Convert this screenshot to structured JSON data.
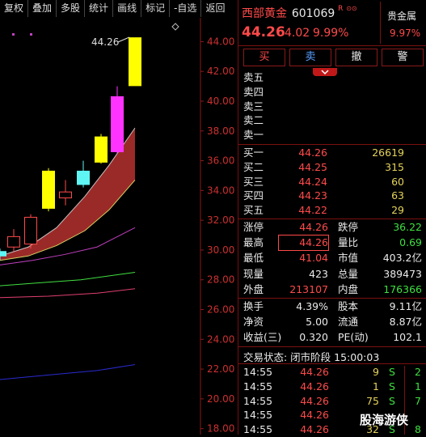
{
  "toolbar": {
    "items": [
      "复权",
      "叠加",
      "多股",
      "统计",
      "画线",
      "标记",
      "-自选",
      "返回"
    ]
  },
  "chart": {
    "peak_label": "44.26",
    "y_ticks": [
      "44.00",
      "42.00",
      "40.00",
      "38.00",
      "36.00",
      "34.00",
      "32.00",
      "30.00",
      "28.00",
      "26.00",
      "24.00",
      "22.00",
      "20.00",
      "18.00"
    ]
  },
  "chart_data": {
    "type": "candlestick",
    "y_range": [
      17.6,
      45.6
    ],
    "candles": [
      {
        "o": 29.6,
        "c": 29.9,
        "h": 30.1,
        "l": 29.3,
        "color": "cyan"
      },
      {
        "o": 30.2,
        "c": 30.9,
        "h": 31.4,
        "l": 29.9,
        "color": "red"
      },
      {
        "o": 30.4,
        "c": 32.2,
        "h": 32.4,
        "l": 30.1,
        "color": "red"
      },
      {
        "o": 32.8,
        "c": 35.3,
        "h": 35.5,
        "l": 32.6,
        "color": "yellow"
      },
      {
        "o": 33.5,
        "c": 33.9,
        "h": 34.7,
        "l": 33.0,
        "color": "red"
      },
      {
        "o": 35.3,
        "c": 34.4,
        "h": 36.0,
        "l": 34.2,
        "color": "cyan"
      },
      {
        "o": 35.9,
        "c": 37.6,
        "h": 37.8,
        "l": 35.8,
        "color": "yellow"
      },
      {
        "o": 36.6,
        "c": 40.3,
        "h": 41.0,
        "l": 36.5,
        "color": "magenta"
      },
      {
        "o": 41.04,
        "c": 44.26,
        "h": 44.26,
        "l": 41.04,
        "color": "yellow"
      }
    ],
    "ma_bands": [
      {
        "color": "#d8d060",
        "points": [
          [
            0,
            29.3
          ],
          [
            35,
            29.6
          ],
          [
            70,
            30.3
          ],
          [
            105,
            31.3
          ],
          [
            135,
            32.7
          ],
          [
            167,
            34.7
          ]
        ]
      },
      {
        "color": "#c7c0c0",
        "points": [
          [
            0,
            29.6
          ],
          [
            35,
            30.2
          ],
          [
            70,
            31.5
          ],
          [
            105,
            33.6
          ],
          [
            135,
            35.7
          ],
          [
            167,
            38.2
          ]
        ]
      },
      {
        "color": "#c040c0",
        "points": [
          [
            0,
            29.0
          ],
          [
            40,
            29.3
          ],
          [
            80,
            29.7
          ],
          [
            120,
            30.2
          ],
          [
            167,
            31.5
          ]
        ]
      },
      {
        "color": "#40e040",
        "points": [
          [
            0,
            27.6
          ],
          [
            50,
            27.8
          ],
          [
            100,
            28.0
          ],
          [
            167,
            28.5
          ]
        ]
      },
      {
        "color": "#e04070",
        "points": [
          [
            0,
            26.8
          ],
          [
            60,
            26.9
          ],
          [
            120,
            27.1
          ],
          [
            167,
            27.4
          ]
        ]
      },
      {
        "color": "#2a2ad0",
        "points": [
          [
            0,
            21.3
          ],
          [
            60,
            21.6
          ],
          [
            120,
            21.9
          ],
          [
            167,
            22.3
          ]
        ]
      }
    ]
  },
  "stock": {
    "name": "西部黄金",
    "code": "601069",
    "tag": "R",
    "price": "44.26",
    "change": "4.02",
    "change_pct": "9.99%",
    "sector": "贵金属",
    "sector_pct": "9.97%"
  },
  "buttons": [
    "买",
    "卖",
    "撤",
    "警"
  ],
  "sell_labels": [
    "卖五",
    "卖四",
    "卖三",
    "卖二",
    "卖一"
  ],
  "buy_levels": [
    {
      "label": "买一",
      "price": "44.26",
      "vol": "26619"
    },
    {
      "label": "买二",
      "price": "44.25",
      "vol": "315"
    },
    {
      "label": "买三",
      "price": "44.24",
      "vol": "60"
    },
    {
      "label": "买四",
      "price": "44.23",
      "vol": "63"
    },
    {
      "label": "买五",
      "price": "44.22",
      "vol": "29"
    }
  ],
  "stats1": [
    {
      "l1": "涨停",
      "v1": "44.26",
      "l2": "跌停",
      "v2": "36.22"
    },
    {
      "l1": "最高",
      "v1": "44.26",
      "l2": "量比",
      "v2": "0.69"
    },
    {
      "l1": "最低",
      "v1": "41.04",
      "l2": "市值",
      "v2": "403.2亿"
    },
    {
      "l1": "现量",
      "v1": "423",
      "l2": "总量",
      "v2": "389473"
    },
    {
      "l1": "外盘",
      "v1": "213107",
      "l2": "内盘",
      "v2": "176366"
    }
  ],
  "stats2": [
    {
      "l1": "换手",
      "v1": "4.39%",
      "l2": "股本",
      "v2": "9.11亿"
    },
    {
      "l1": "净资",
      "v1": "5.00",
      "l2": "流通",
      "v2": "8.87亿"
    },
    {
      "l1": "收益(三)",
      "v1": "0.320",
      "l2": "PE(动)",
      "v2": "102.1"
    }
  ],
  "trade_status": "交易状态: 闭市阶段 15:00:03",
  "ticks": [
    {
      "time": "14:55",
      "price": "44.26",
      "vol": "9",
      "flag": "S",
      "n": "2"
    },
    {
      "time": "14:55",
      "price": "44.26",
      "vol": "1",
      "flag": "S",
      "n": "1"
    },
    {
      "time": "14:55",
      "price": "44.26",
      "vol": "75",
      "flag": "S",
      "n": "7"
    },
    {
      "time": "14:55",
      "price": "44.26",
      "vol": "",
      "flag": "",
      "n": ""
    },
    {
      "time": "14:55",
      "price": "44.26",
      "vol": "32",
      "flag": "S",
      "n": "8"
    }
  ],
  "watermark": "股海游侠"
}
